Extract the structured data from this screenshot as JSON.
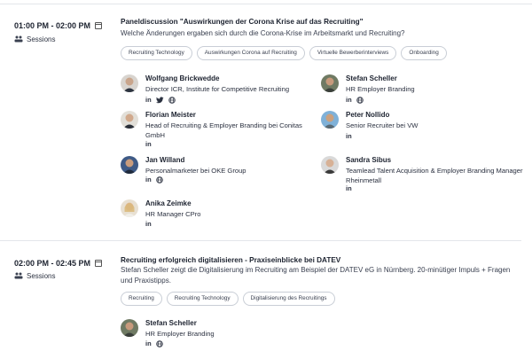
{
  "sessions": [
    {
      "time": "01:00 PM - 02:00 PM",
      "type": "Sessions",
      "title": "Paneldiscussion \"Auswirkungen der Corona Krise auf das Recruiting\"",
      "description": "Welche Änderungen ergaben sich durch die Corona-Krise im Arbeitsmarkt und Recruiting?",
      "tags": [
        "Recruiting Technology",
        "Auswirkungen Corona auf Recruiting",
        "Virtuelle Bewerberinterviews",
        "Onboarding"
      ],
      "speakers": [
        {
          "name": "Wolfgang Brickwedde",
          "role": "Director ICR, Institute for Competitive Recruiting",
          "social": [
            "in",
            "twitter",
            "web"
          ]
        },
        {
          "name": "Stefan Scheller",
          "role": "HR Employer Branding",
          "social": [
            "in",
            "web"
          ]
        },
        {
          "name": "Florian Meister",
          "role": "Head of Recruiting & Employer Branding bei Conitas GmbH",
          "social": [
            "in"
          ]
        },
        {
          "name": "Peter Nollido",
          "role": "Senior Recruiter bei VW",
          "social": [
            "in"
          ]
        },
        {
          "name": "Jan Willand",
          "role": "Personalmarketer bei OKE Group",
          "social": [
            "in",
            "web"
          ]
        },
        {
          "name": "Sandra Sibus",
          "role": "Teamlead Talent Acquisition & Employer Branding Manager Rheinmetall",
          "social": [
            "in"
          ]
        },
        {
          "name": "Anika Zeimke",
          "role": "HR Manager CPro",
          "social": [
            "in"
          ]
        }
      ]
    },
    {
      "time": "02:00 PM - 02:45 PM",
      "type": "Sessions",
      "title": "Recruiting erfolgreich digitalisieren - Praxiseinblicke bei DATEV",
      "description": "Stefan Scheller zeigt die Digitalisierung im Recruiting am Beispiel der DATEV eG in Nürnberg. 20-minütiger Impuls + Fragen und Praxistipps.",
      "tags": [
        "Recruiting",
        "Recruiting Technology",
        "Digitalisierung des Recruitings"
      ],
      "speakers": [
        {
          "name": "Stefan Scheller",
          "role": "HR Employer Branding",
          "social": [
            "in",
            "web"
          ]
        }
      ]
    }
  ],
  "social_labels": {
    "in": "in"
  },
  "icons": {
    "calendar": "calendar-icon",
    "sessions": "people-icon",
    "linkedin": "linkedin-icon",
    "twitter": "twitter-icon",
    "web": "globe-icon"
  },
  "colors": {
    "text": "#1d2330",
    "border": "#c9ced6",
    "separator": "#e3e6ea"
  }
}
